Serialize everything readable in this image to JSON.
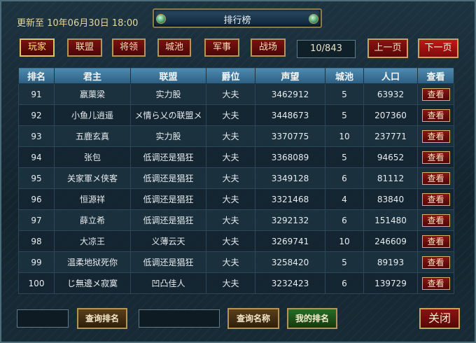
{
  "header": {
    "update_text": "更新至 10年06月30日 18:00",
    "title": "排行榜"
  },
  "tabs": [
    {
      "label": "玩家",
      "active": true
    },
    {
      "label": "联盟",
      "active": false
    },
    {
      "label": "将领",
      "active": false
    },
    {
      "label": "城池",
      "active": false
    },
    {
      "label": "军事",
      "active": false
    },
    {
      "label": "战场",
      "active": false
    }
  ],
  "pagination": {
    "page_text": "10/843",
    "prev_label": "上一页",
    "next_label": "下一页"
  },
  "table": {
    "columns": [
      "排名",
      "君主",
      "联盟",
      "爵位",
      "声望",
      "城池",
      "人口",
      "查看"
    ],
    "rows": [
      {
        "rank": "91",
        "lord": "嬴蕖梁",
        "alliance": "实力股",
        "title": "大夫",
        "fame": "3462912",
        "cities": "5",
        "population": "63932",
        "view": "查看"
      },
      {
        "rank": "92",
        "lord": "小鱼儿逍遥",
        "alliance": "メ情ら乂の联盟メ",
        "title": "大夫",
        "fame": "3448673",
        "cities": "5",
        "population": "207360",
        "view": "查看"
      },
      {
        "rank": "93",
        "lord": "五鹿玄真",
        "alliance": "实力股",
        "title": "大夫",
        "fame": "3370775",
        "cities": "10",
        "population": "237771",
        "view": "查看"
      },
      {
        "rank": "94",
        "lord": "张包",
        "alliance": "低调还是猖狂",
        "title": "大夫",
        "fame": "3368089",
        "cities": "5",
        "population": "94652",
        "view": "查看"
      },
      {
        "rank": "95",
        "lord": "关家軍メ侠客",
        "alliance": "低调还是猖狂",
        "title": "大夫",
        "fame": "3349128",
        "cities": "6",
        "population": "81112",
        "view": "查看"
      },
      {
        "rank": "96",
        "lord": "恒源祥",
        "alliance": "低调还是猖狂",
        "title": "大夫",
        "fame": "3321468",
        "cities": "4",
        "population": "83840",
        "view": "查看"
      },
      {
        "rank": "97",
        "lord": "薛立希",
        "alliance": "低调还是猖狂",
        "title": "大夫",
        "fame": "3292132",
        "cities": "6",
        "population": "151480",
        "view": "查看"
      },
      {
        "rank": "98",
        "lord": "大凉王",
        "alliance": "义薄云天",
        "title": "大夫",
        "fame": "3269741",
        "cities": "10",
        "population": "246609",
        "view": "查看"
      },
      {
        "rank": "99",
        "lord": "温柔地狱死你",
        "alliance": "低调还是猖狂",
        "title": "大夫",
        "fame": "3258420",
        "cities": "5",
        "population": "89193",
        "view": "查看"
      },
      {
        "rank": "100",
        "lord": "じ無邊メ寂寞",
        "alliance": "凹凸佳人",
        "title": "大夫",
        "fame": "3232423",
        "cities": "6",
        "population": "139729",
        "view": "查看"
      }
    ]
  },
  "footer": {
    "rank_input_value": "",
    "name_input_value": "",
    "query_rank_label": "查询排名",
    "query_name_label": "查询名称",
    "my_rank_label": "我的排名",
    "close_label": "关闭"
  },
  "colors": {
    "accent_gold": "#b59457",
    "button_red": "#7a1111",
    "header_blue": "#3a7399",
    "gem_green": "#3fa06a"
  }
}
